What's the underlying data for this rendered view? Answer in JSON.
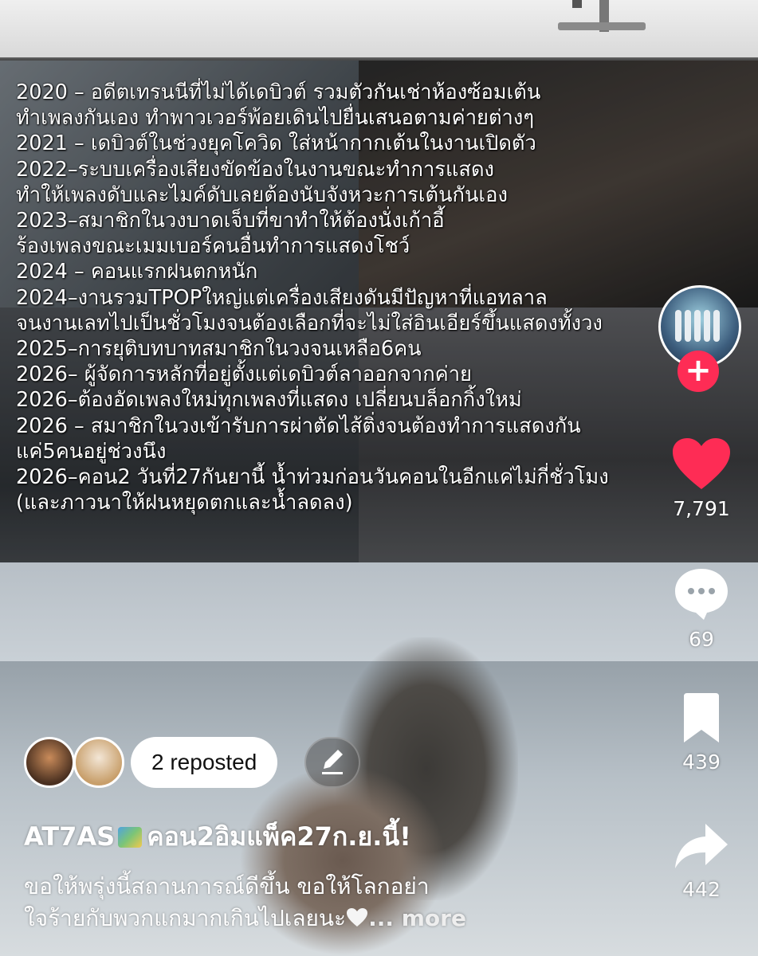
{
  "overlay_lines": [
    "2020 – อดีตเทรนนีที่ไม่ได้เดบิวต์ รวมตัวกันเช่าห้องซ้อมเต้น",
    " ทำเพลงกันเอง ทำพาวเวอร์พ้อยเดินไปยื่นเสนอตามค่ายต่างๆ",
    "2021 – เดบิวต์ในช่วงยุคโควิด ใส่หน้ากากเต้นในงานเปิดตัว",
    "2022–ระบบเครื่องเสียงขัดข้องในงานขณะทำการแสดง",
    " ทำให้เพลงดับและไมค์ดับเลยต้องนับจังหวะการเต้นกันเอง",
    "2023–สมาชิกในวงบาดเจ็บที่ขาทำให้ต้องนั่งเก้าอี้",
    "ร้องเพลงขณะเมมเบอร์คนอื่นทำการแสดงโชว์",
    "2024 – คอนแรกฝนตกหนัก",
    "2024–งานรวมTPOPใหญ่แต่เครื่องเสียงดันมีปัญหาที่แอทลาล",
    "จนงานเลทไปเป็นชั่วโมงจนต้องเลือกที่จะไม่ใส่อินเอียร์ขึ้นแสดงทั้งวง",
    "2025–การยุติบทบาทสมาชิกในวงจนเหลือ6คน",
    "2026– ผู้จัดการหลักที่อยู่ตั้งแต่เดบิวต์ลาออกจากค่าย",
    "2026–ต้องอัดเพลงใหม่ทุกเพลงที่แสดง เปลี่ยนบล็อกกิ้งใหม่",
    "2026 – สมาชิกในวงเข้ารับการผ่าตัดไส้ติ่งจนต้องทำการแสดงกัน",
    "แค่5คนอยู่ช่วงนึง",
    "2026–คอน2 วันที่27กันยานี้ น้ำท่วมก่อนวันคอนในอีกแค่ไม่กี่ชั่วโมง",
    "(และภาวนาให้ฝนหยุดตกและน้ำลดลง)"
  ],
  "actions": {
    "likes": "7,791",
    "comments": "69",
    "saves": "439",
    "shares": "442"
  },
  "repost": {
    "label": "2 reposted"
  },
  "post": {
    "username": "AT7AS",
    "title": "คอน2อิมแพ็ค27ก.ย.นี้!",
    "caption_line1": "ขอให้พรุ่งนี้สถานการณ์ดีขึ้น ขอให้โลกอย่า",
    "caption_line2": "ใจร้ายกับพวกแกมากเกินไปเลยนะ",
    "more_label": "... more"
  },
  "colors": {
    "like_red": "#fe2c55",
    "text_white": "#ffffff"
  },
  "icons": {
    "follow": "plus-icon",
    "like": "heart-icon",
    "comment": "comment-icon",
    "save": "bookmark-icon",
    "share": "share-icon",
    "edit": "pencil-icon"
  }
}
